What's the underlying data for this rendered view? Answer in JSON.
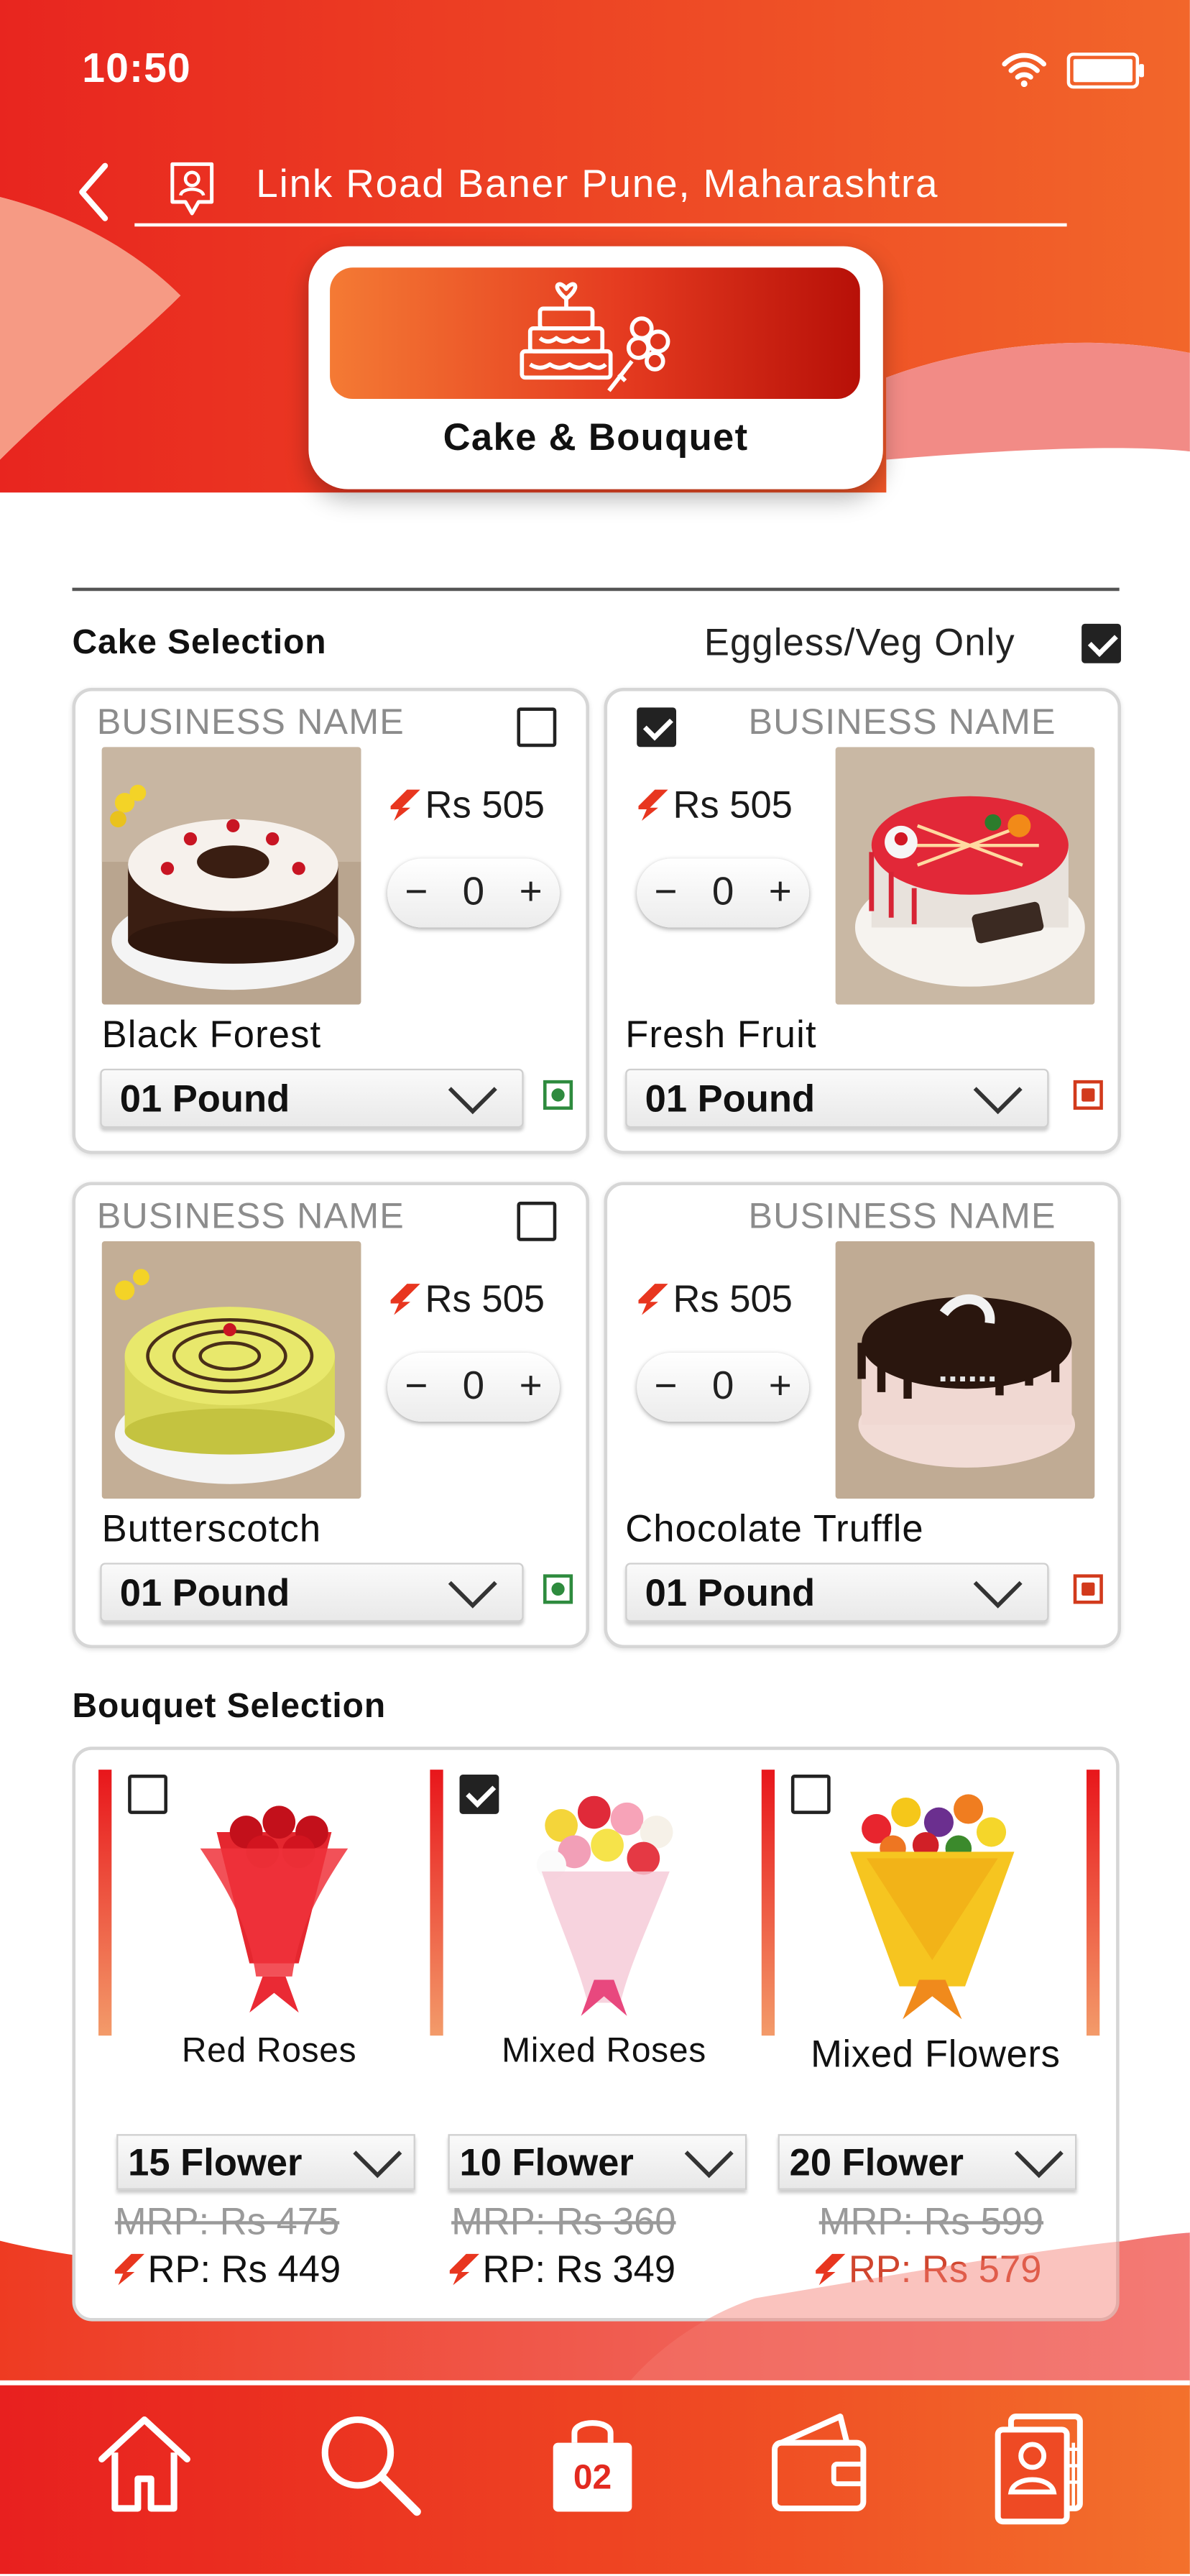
{
  "status": {
    "time": "10:50"
  },
  "header": {
    "location": "Link Road Baner Pune, Maharashtra"
  },
  "category": {
    "label": "Cake & Bouquet"
  },
  "colors": {
    "primary": "#ed3e22",
    "accent_dark": "#b71008",
    "veg": "#2e8b3e",
    "nonveg": "#d23a1c"
  },
  "cakes": {
    "title": "Cake Selection",
    "filter_label": "Eggless/Veg Only",
    "filter_checked": true,
    "items": [
      {
        "business": "BUSINESS NAME",
        "price": "Rs 505",
        "qty": "0",
        "name": "Black Forest",
        "size": "01 Pound",
        "checked": false,
        "veg": true
      },
      {
        "business": "BUSINESS NAME",
        "price": "Rs 505",
        "qty": "0",
        "name": "Fresh Fruit",
        "size": "01 Pound",
        "checked": true,
        "veg": false
      },
      {
        "business": "BUSINESS NAME",
        "price": "Rs 505",
        "qty": "0",
        "name": "Butterscotch",
        "size": "01 Pound",
        "checked": false,
        "veg": true
      },
      {
        "business": "BUSINESS NAME",
        "price": "Rs 505",
        "qty": "0",
        "name": "Chocolate Truffle",
        "size": "01 Pound",
        "checked": false,
        "veg": false
      }
    ]
  },
  "bouquets": {
    "title": "Bouquet Selection",
    "items": [
      {
        "name": "Red Roses",
        "count": "15 Flower",
        "mrp": "MRP: Rs 475",
        "rp": "RP: Rs 449",
        "checked": false
      },
      {
        "name": "Mixed Roses",
        "count": "10 Flower",
        "mrp": "MRP: Rs 360",
        "rp": "RP: Rs 349",
        "checked": true
      },
      {
        "name": "Mixed Flowers",
        "count": "20 Flower",
        "mrp": "MRP: Rs 599",
        "rp": "RP: Rs 579",
        "checked": false
      }
    ]
  },
  "nav": {
    "cart_count": "02",
    "icons": [
      "home-icon",
      "search-icon",
      "cart-bag-icon",
      "wallet-icon",
      "profile-book-icon"
    ]
  }
}
